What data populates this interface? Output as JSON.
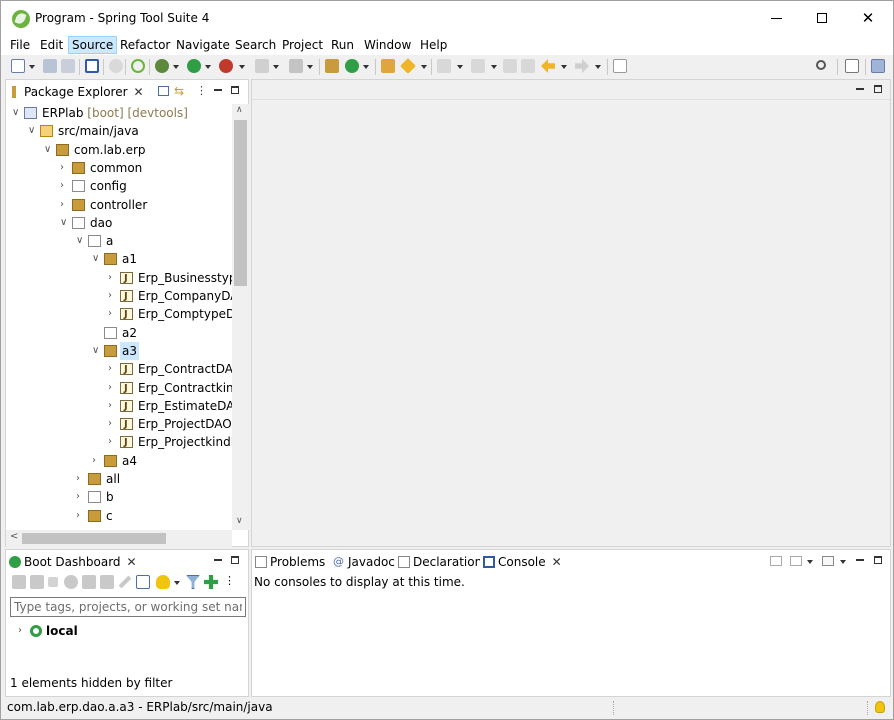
{
  "window": {
    "title": "Program - Spring Tool Suite 4"
  },
  "menu": [
    "File",
    "Edit",
    "Source",
    "Refactor",
    "Navigate",
    "Search",
    "Project",
    "Run",
    "Window",
    "Help"
  ],
  "package_explorer": {
    "tab_label": "Package Explorer",
    "tree": [
      {
        "label": "ERPlab",
        "decoration": " [boot] [devtools]",
        "icon": "project-icon",
        "expanded": true
      },
      {
        "label": "src/main/java",
        "icon": "source-folder-icon",
        "expanded": true
      },
      {
        "label": "com.lab.erp",
        "icon": "package-icon",
        "expanded": true
      },
      {
        "label": "common",
        "icon": "package-icon",
        "expanded": false
      },
      {
        "label": "config",
        "icon": "empty-package-icon",
        "expanded": false
      },
      {
        "label": "controller",
        "icon": "package-icon",
        "expanded": false
      },
      {
        "label": "dao",
        "icon": "empty-package-icon",
        "expanded": true
      },
      {
        "label": "a",
        "icon": "empty-package-icon",
        "expanded": true
      },
      {
        "label": "a1",
        "icon": "package-icon",
        "expanded": true
      },
      {
        "label": "Erp_BusinesstypeI",
        "icon": "java-file-icon",
        "expanded": false
      },
      {
        "label": "Erp_CompanyDAC",
        "icon": "java-file-icon",
        "expanded": false
      },
      {
        "label": "Erp_ComptypeDA",
        "icon": "java-file-icon",
        "expanded": false
      },
      {
        "label": "a2",
        "icon": "empty-package-icon",
        "expanded": null
      },
      {
        "label": "a3",
        "icon": "package-icon",
        "expanded": true,
        "selected": true
      },
      {
        "label": "Erp_ContractDAC",
        "icon": "java-file-icon",
        "expanded": false
      },
      {
        "label": "Erp_Contractkind",
        "icon": "java-file-icon",
        "expanded": false
      },
      {
        "label": "Erp_EstimateDAO",
        "icon": "java-file-icon",
        "expanded": false
      },
      {
        "label": "Erp_ProjectDAO.j",
        "icon": "java-file-icon",
        "expanded": false
      },
      {
        "label": "Erp_ProjectkindD",
        "icon": "java-file-icon",
        "expanded": false
      },
      {
        "label": "a4",
        "icon": "package-icon",
        "expanded": false
      },
      {
        "label": "all",
        "icon": "package-icon",
        "expanded": false
      },
      {
        "label": "b",
        "icon": "empty-package-icon",
        "expanded": false
      },
      {
        "label": "c",
        "icon": "package-icon",
        "expanded": false
      }
    ]
  },
  "boot_dashboard": {
    "tab_label": "Boot Dashboard",
    "filter_placeholder": "Type tags, projects, or working set names",
    "local_label": "local",
    "hidden_message": "1 elements hidden by filter"
  },
  "bottom_tabs": {
    "problems": "Problems",
    "javadoc": "Javadoc",
    "declaration": "Declaration",
    "console": "Console"
  },
  "console": {
    "message": "No consoles to display at this time."
  },
  "status": {
    "text": "com.lab.erp.dao.a.a3 - ERPlab/src/main/java"
  },
  "colors": {
    "selection": "#cce8ff",
    "spring_green": "#6db33f",
    "package_brown": "#c89b3c"
  }
}
